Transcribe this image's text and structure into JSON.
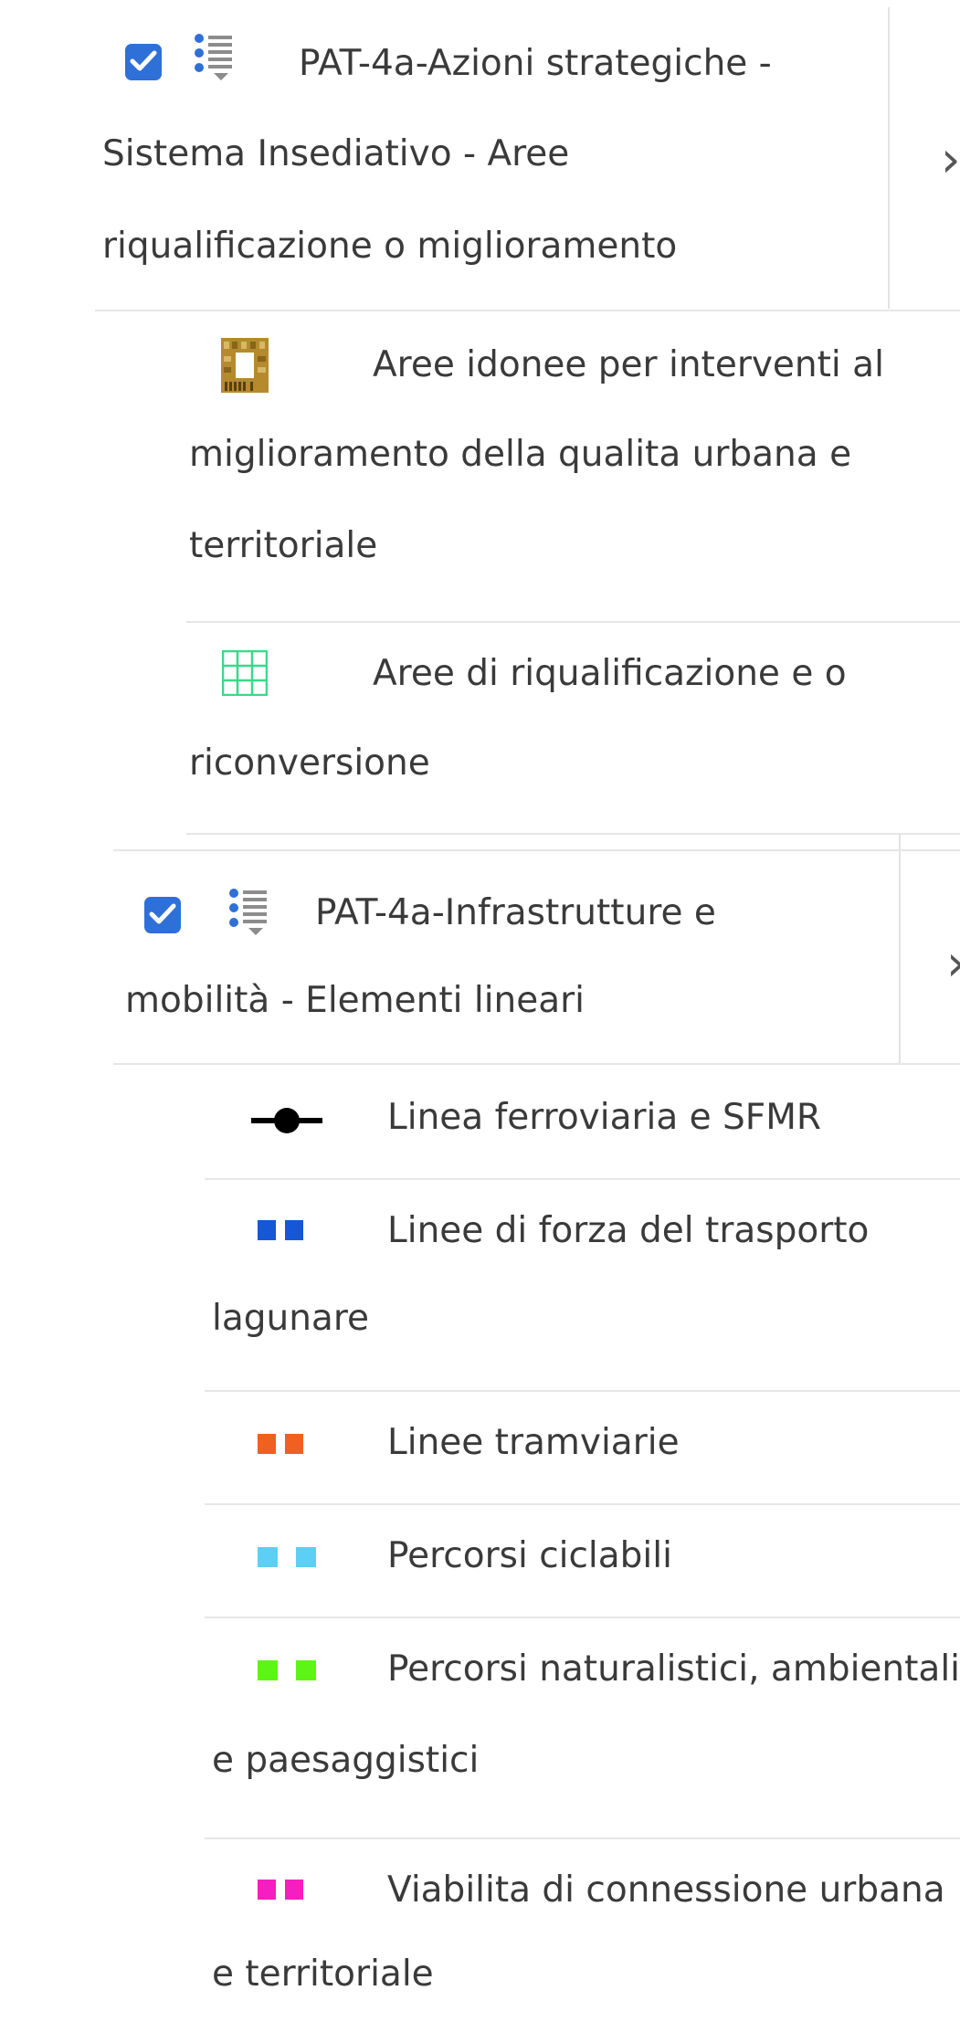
{
  "groups": [
    {
      "title_line1": "PAT-4a-Azioni strategiche -",
      "title_line2": "Sistema Insediativo - Aree",
      "title_line3": "riqualificazione o miglioramento",
      "checked": true,
      "expand_icon": "chevron-right-icon",
      "items": [
        {
          "line1": "Aree idonee per interventi al",
          "line2": "miglioramento della qualita urbana e",
          "line3": "territoriale",
          "symbol": "gold-pattern-square"
        },
        {
          "line1": "Aree di riqualificazione e o",
          "line2": "riconversione",
          "symbol": "green-grid"
        }
      ]
    },
    {
      "title_line1": "PAT-4a-Infrastrutture e",
      "title_line2": "mobilità - Elementi lineari",
      "checked": true,
      "expand_icon": "chevron-right-icon",
      "items": [
        {
          "line1": "Linea ferroviaria e SFMR",
          "symbol": "rail-line",
          "color": "#000000"
        },
        {
          "line1": "Linee di forza del trasporto",
          "line2": "lagunare",
          "symbol": "dashed-line",
          "color": "#1557d6"
        },
        {
          "line1": "Linee tramviarie",
          "symbol": "dashed-line",
          "color": "#f0601e"
        },
        {
          "line1": "Percorsi ciclabili",
          "symbol": "dashed-line",
          "color": "#5ccff5"
        },
        {
          "line1": "Percorsi naturalistici, ambientali",
          "line2": "e paesaggistici",
          "symbol": "dashed-line",
          "color": "#5cf516"
        },
        {
          "line1": "Viabilita di connessione urbana",
          "line2": "e territoriale",
          "symbol": "dashed-line",
          "color": "#f51ec0"
        }
      ]
    }
  ]
}
